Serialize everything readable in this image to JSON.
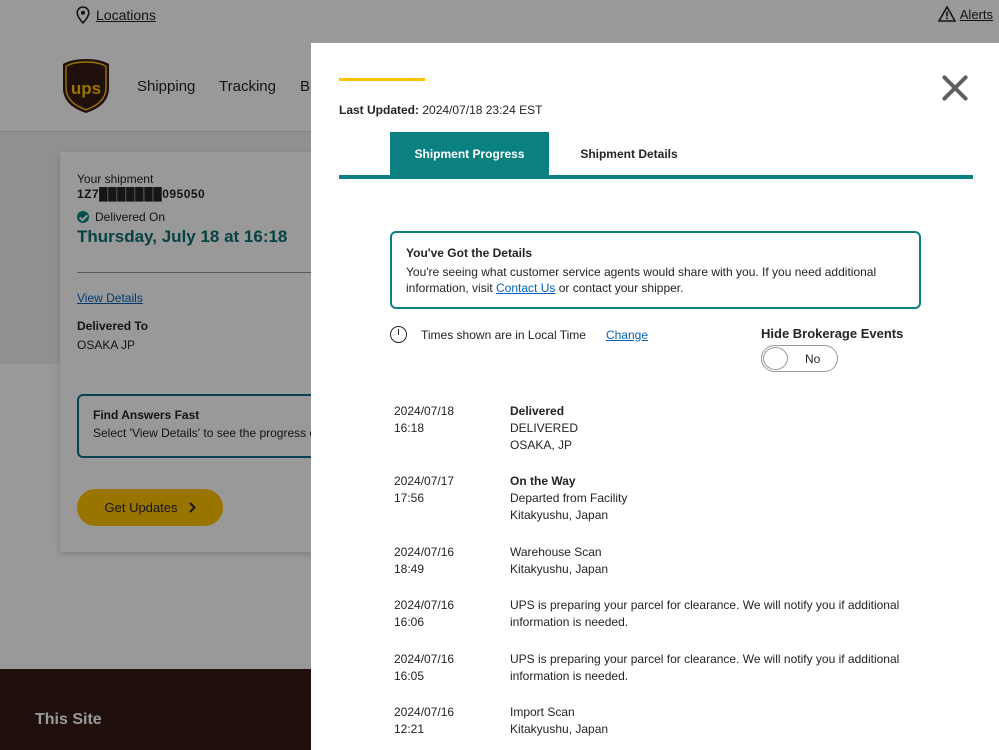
{
  "background": {
    "utility": {
      "locations": "Locations",
      "alerts": "Alerts"
    },
    "nav": {
      "items": [
        "Shipping",
        "Tracking",
        "B"
      ]
    },
    "card": {
      "your_shipment": "Your shipment",
      "tracking_number": "1Z7███████095050",
      "delivered_on": "Delivered On",
      "date": "Thursday, July 18 at 16:18",
      "view_details": "View Details",
      "delivered_to_label": "Delivered To",
      "delivered_to_value": "OSAKA JP",
      "faq_title": "Find Answers Fast",
      "faq_desc": "Select 'View Details' to see the progress o",
      "get_updates": "Get Updates"
    },
    "footer_title": "This Site"
  },
  "modal": {
    "last_updated_label": "Last Updated:",
    "last_updated_value": "2024/07/18 23:24 EST",
    "tabs": [
      {
        "label": "Shipment Progress",
        "active": true
      },
      {
        "label": "Shipment Details",
        "active": false
      }
    ],
    "info": {
      "title": "You've Got the Details",
      "text_before": "You're seeing what customer service agents would share with you. If you need additional information, visit ",
      "link": "Contact Us",
      "text_after": " or contact your shipper."
    },
    "times_note": "Times shown are in Local Time",
    "change": "Change",
    "hide_brokerage": "Hide Brokerage Events",
    "toggle_value": "No",
    "events": [
      {
        "date": "2024/07/18",
        "time": "16:18",
        "status": "Delivered",
        "bold": true,
        "lines": [
          "DELIVERED",
          "OSAKA, JP"
        ]
      },
      {
        "date": "2024/07/17",
        "time": "17:56",
        "status": "On the Way",
        "bold": true,
        "lines": [
          "Departed from Facility",
          "Kitakyushu, Japan"
        ]
      },
      {
        "date": "2024/07/16",
        "time": "18:49",
        "status": "Warehouse Scan",
        "bold": false,
        "lines": [
          "Kitakyushu, Japan"
        ]
      },
      {
        "date": "2024/07/16",
        "time": "16:06",
        "status": "UPS is preparing your parcel for clearance. We will notify you if additional information is needed.",
        "bold": false,
        "lines": []
      },
      {
        "date": "2024/07/16",
        "time": "16:05",
        "status": "UPS is preparing your parcel for clearance. We will notify you if additional information is needed.",
        "bold": false,
        "lines": []
      },
      {
        "date": "2024/07/16",
        "time": "12:21",
        "status": "Import Scan",
        "bold": false,
        "lines": [
          "Kitakyushu, Japan"
        ]
      }
    ]
  },
  "colors": {
    "teal": "#0a8080",
    "ups_brown": "#351c15",
    "ups_gold": "#ffc400",
    "link": "#0662bb"
  }
}
